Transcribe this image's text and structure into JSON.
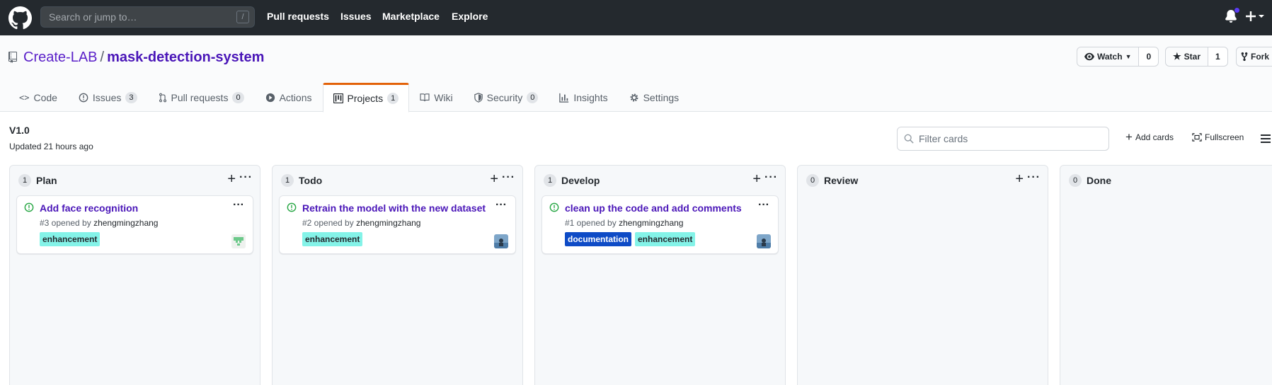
{
  "header": {
    "search_placeholder": "Search or jump to…",
    "search_shortcut": "/",
    "nav": [
      "Pull requests",
      "Issues",
      "Marketplace",
      "Explore"
    ]
  },
  "repo": {
    "owner": "Create-LAB",
    "separator": "/",
    "name": "mask-detection-system",
    "watch_label": "Watch",
    "watch_count": "0",
    "star_label": "Star",
    "star_count": "1",
    "fork_label": "Fork"
  },
  "tabs": [
    {
      "label": "Code",
      "icon": "code-icon"
    },
    {
      "label": "Issues",
      "icon": "issue-icon",
      "count": "3"
    },
    {
      "label": "Pull requests",
      "icon": "pull-request-icon",
      "count": "0"
    },
    {
      "label": "Actions",
      "icon": "play-icon"
    },
    {
      "label": "Projects",
      "icon": "project-icon",
      "count": "1",
      "active": true
    },
    {
      "label": "Wiki",
      "icon": "book-icon"
    },
    {
      "label": "Security",
      "icon": "shield-icon",
      "count": "0"
    },
    {
      "label": "Insights",
      "icon": "graph-icon"
    },
    {
      "label": "Settings",
      "icon": "gear-icon"
    }
  ],
  "project": {
    "name": "V1.0",
    "updated": "Updated 21 hours ago",
    "filter_placeholder": "Filter cards",
    "add_cards": "Add cards",
    "fullscreen": "Fullscreen"
  },
  "columns": [
    {
      "title": "Plan",
      "count": "1",
      "card": {
        "title": "Add face recognition",
        "number": "#3 opened by ",
        "author": "zhengmingzhang",
        "labels": [
          "enhancement"
        ]
      }
    },
    {
      "title": "Todo",
      "count": "1",
      "card": {
        "title": "Retrain the model with the new dataset",
        "number": "#2 opened by ",
        "author": "zhengmingzhang",
        "labels": [
          "enhancement"
        ]
      }
    },
    {
      "title": "Develop",
      "count": "1",
      "card": {
        "title": "clean up the code and add comments",
        "number": "#1 opened by ",
        "author": "zhengmingzhang",
        "labels": [
          "documentation",
          "enhancement"
        ]
      }
    },
    {
      "title": "Review",
      "count": "0"
    },
    {
      "title": "Done",
      "count": "0"
    }
  ],
  "colors": {
    "header_bg": "#24292e",
    "issue_open": "#28a745",
    "label_enhancement": "#84f3e8",
    "label_documentation": "#0e4bc6",
    "active_tab_accent": "#e36209"
  }
}
